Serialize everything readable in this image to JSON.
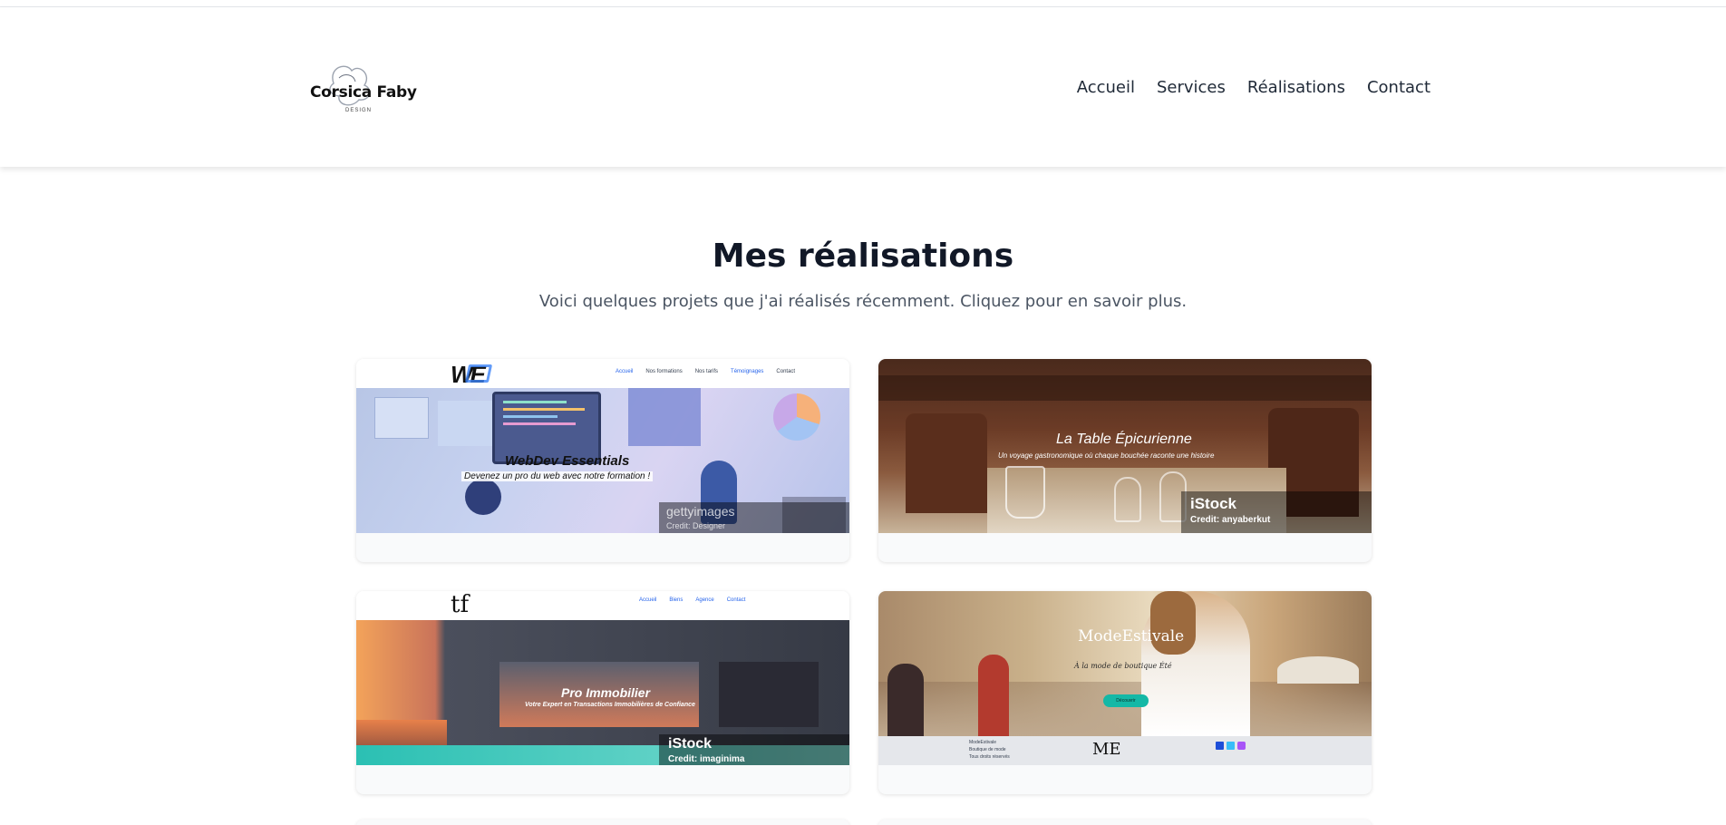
{
  "brand": {
    "name": "Corsica Faby",
    "tagline": "DESIGN"
  },
  "nav": {
    "items": [
      "Accueil",
      "Services",
      "Réalisations",
      "Contact"
    ]
  },
  "section": {
    "title": "Mes réalisations",
    "subtitle": "Voici quelques projets que j'ai réalisés récemment. Cliquez pour en savoir plus."
  },
  "projects": [
    {
      "logo": "WE",
      "nav_links": [
        "Accueil",
        "Nos formations",
        "Nos tarifs",
        "Témoignages",
        "Contact"
      ],
      "title": "WebDev Essentials",
      "subtitle": "Devenez un pro du web avec notre formation !",
      "credit_brand": "gettyimages",
      "credit_text": "Credit: Designer"
    },
    {
      "title": "La Table Épicurienne",
      "subtitle": "Un voyage gastronomique où chaque bouchée raconte une histoire",
      "credit_brand": "iStock",
      "credit_text": "Credit: anyaberkut"
    },
    {
      "logo": "tf",
      "nav_links": [
        "Accueil",
        "Biens",
        "Agence",
        "Contact"
      ],
      "title": "Pro Immobilier",
      "subtitle": "Votre Expert en Transactions Immobilières de Confiance",
      "credit_brand": "iStock",
      "credit_text": "Credit: imaginima"
    },
    {
      "title": "ModeEstivale",
      "subtitle": "À la mode de boutique Été",
      "button": "Découvrir",
      "footer_logo": "ME",
      "footer_text": [
        "ModeEstivale",
        "Boutique de mode",
        "Tous droits réservés"
      ]
    }
  ],
  "colors": {
    "title": "#111827",
    "subtitle": "#4b5563",
    "nav_text": "#1f2937",
    "card_bg": "#f9fafb",
    "teal_button": "#14b8a6"
  }
}
